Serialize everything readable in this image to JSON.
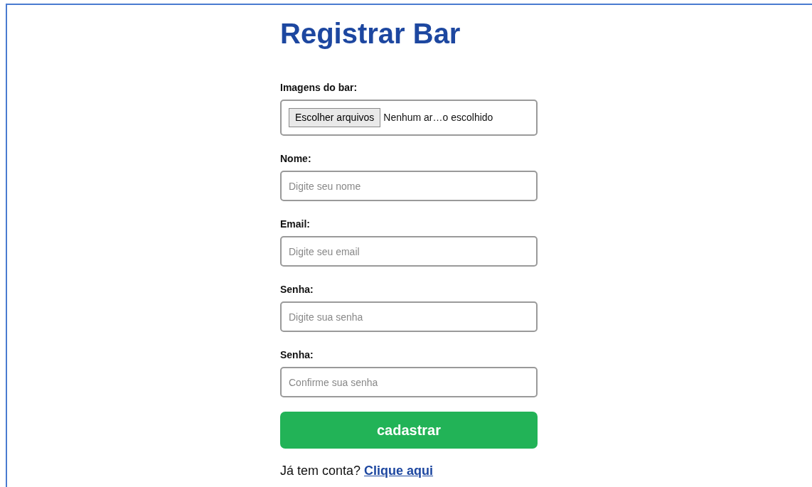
{
  "title": "Registrar Bar",
  "file_field": {
    "label": "Imagens do bar:",
    "button": "Escolher arquivos",
    "status": "Nenhum ar…o escolhido"
  },
  "fields": [
    {
      "label": "Nome:",
      "placeholder": "Digite seu nome"
    },
    {
      "label": "Email:",
      "placeholder": "Digite seu email"
    },
    {
      "label": "Senha:",
      "placeholder": "Digite sua senha"
    },
    {
      "label": "Senha:",
      "placeholder": "Confirme sua senha"
    }
  ],
  "submit": "cadastrar",
  "login_prompt": {
    "text": "Já tem conta?",
    "link": "Clique aqui"
  }
}
